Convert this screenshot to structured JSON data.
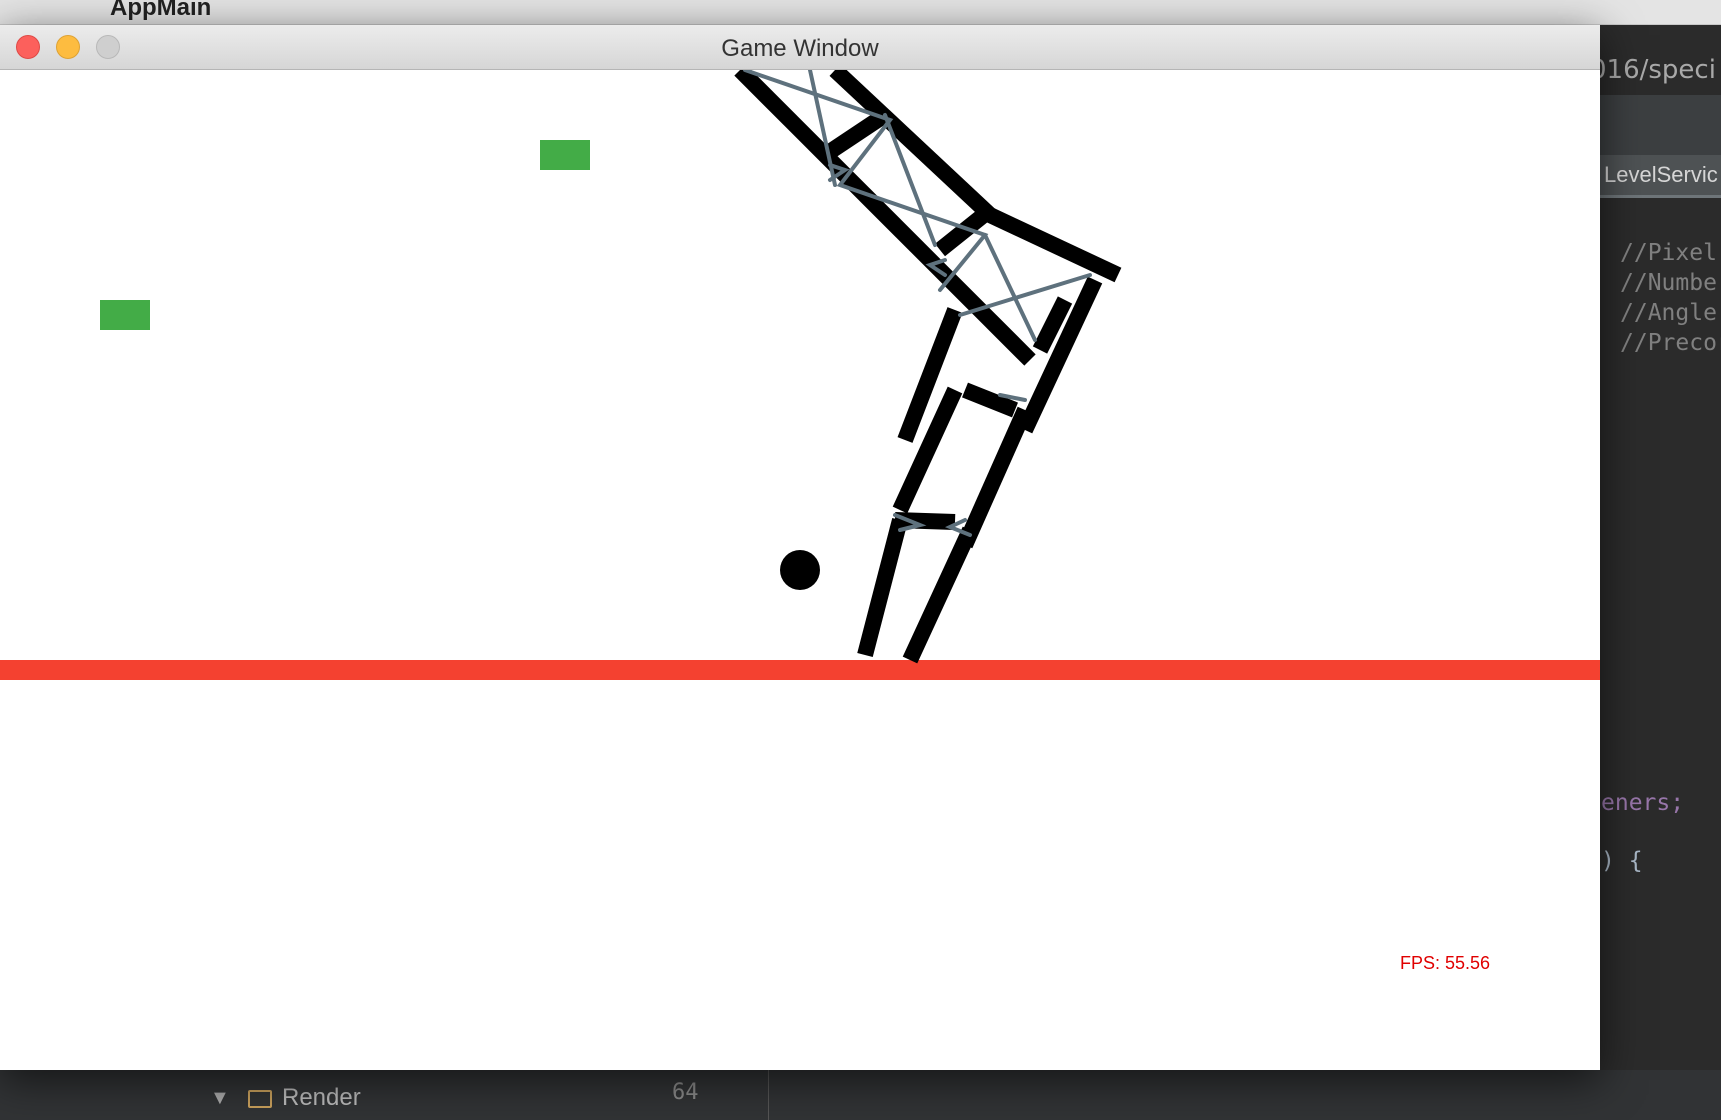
{
  "menubar": {
    "app_name": "AppMain"
  },
  "ide": {
    "path_fragment": "016/speci",
    "tab_label": "LevelServic",
    "comments": [
      "//Pixel",
      "//Numbe",
      "//Angle",
      "//Precor"
    ],
    "code_fragment_1": "eners;",
    "code_fragment_2": ") {",
    "tree_label": "Render",
    "line_number": "64"
  },
  "window": {
    "title": "Game Window",
    "fps_text": "FPS: 55.56"
  },
  "colors": {
    "ground": "#f44130",
    "goal": "#43ac47",
    "structure": "#000000",
    "spring": "#5e717d",
    "fps": "#e00000"
  }
}
